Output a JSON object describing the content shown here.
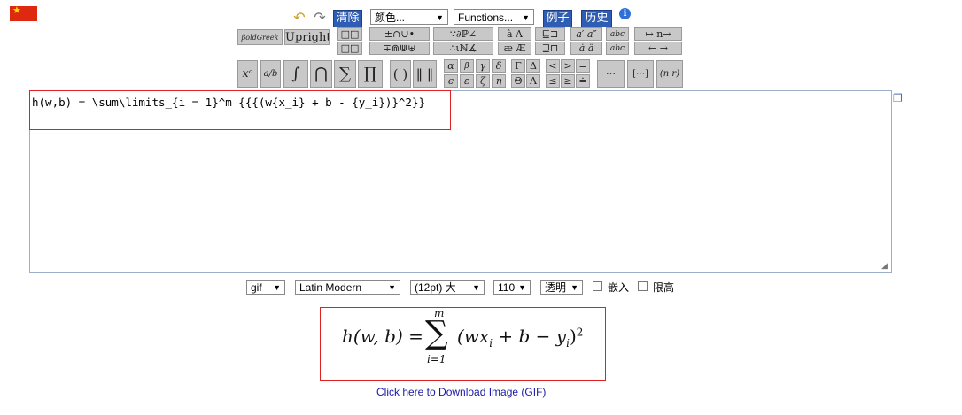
{
  "toolbar": {
    "undo_icon": "undo-icon",
    "redo_icon": "redo-icon",
    "clear_label": "清除",
    "color_select": "颜色...",
    "functions_select": "Functions...",
    "examples_label": "例子",
    "history_label": "历史",
    "info_icon": "info-icon"
  },
  "palette": {
    "boldgreek": "βoldGreek",
    "upright": "Upright",
    "row1": [
      "□□",
      "±∩∪•",
      "∵∂ℙ∠",
      "à A",
      "⊑⊐",
      "a′ a″",
      "abc",
      "↦ n→"
    ],
    "row2": [
      "□□",
      "∓⋒⋓⊎",
      "∴ιℕ∡",
      "æ Æ",
      "⊒⊓",
      "ȧ ä",
      "abc",
      "← →"
    ],
    "big": [
      "xᵃ",
      "a/b",
      "∫",
      "⋂",
      "∑",
      "∏",
      "( )",
      "‖ ‖"
    ],
    "greek_top": [
      "α",
      "β",
      "γ",
      "δ",
      "Γ",
      "Δ",
      "<",
      ">",
      "="
    ],
    "greek_bot": [
      "ϵ",
      "ε",
      "ζ",
      "η",
      "Θ",
      "Λ",
      "≤",
      "≥",
      "≐"
    ],
    "matrix": [
      "⋅⋅⋅",
      "[⋯]",
      "(n r)"
    ]
  },
  "editor": {
    "latex": "h(w,b) = \\sum\\limits_{i = 1}^m {{{(w{x_i} + b - {y_i})}^2}}"
  },
  "options": {
    "format": "gif",
    "font": "Latin Modern",
    "size": "(12pt) 大",
    "dpi": "110",
    "background": "透明",
    "embed_label": "嵌入",
    "limit_height_label": "限高"
  },
  "output": {
    "lhs": "h(w, b) =",
    "sum_top": "m",
    "sum_bottom": "i=1",
    "body": "(wx",
    "sub_i": "i",
    "body2": " + b − y",
    "sub_i2": "i",
    "close": ")",
    "exp": "2"
  },
  "download_link": "Click here to Download Image (GIF)"
}
